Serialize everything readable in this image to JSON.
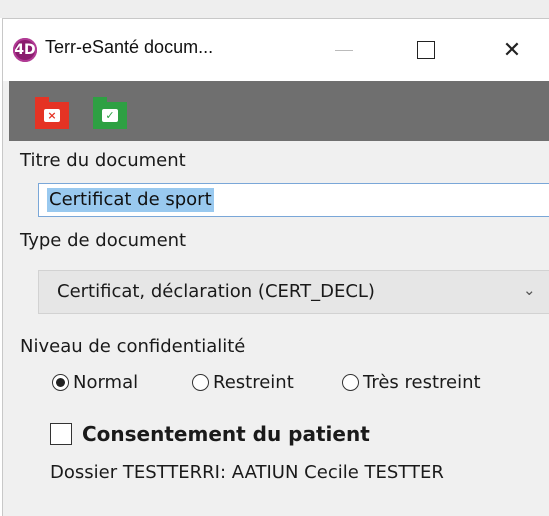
{
  "window": {
    "title": "Terr-eSanté docum...",
    "app_icon_letter": "4D",
    "minimize_glyph": "—",
    "close_glyph": "✕"
  },
  "toolbar": {
    "cancel_icon": "folder-cancel-icon",
    "cancel_glyph": "×",
    "cancel_color": "#e53324",
    "ok_icon": "folder-check-icon",
    "ok_glyph": "✓",
    "ok_color": "#2ea043"
  },
  "form": {
    "titre_label": "Titre du document",
    "titre_value": "Certificat de sport",
    "type_label": "Type de document",
    "type_value": "Certificat, déclaration (CERT_DECL)",
    "niveau_label": "Niveau de confidentialité",
    "niveau_options": [
      {
        "label": "Normal",
        "selected": true
      },
      {
        "label": "Restreint",
        "selected": false
      },
      {
        "label": "Très restreint",
        "selected": false
      }
    ],
    "consent_label": "Consentement du patient",
    "consent_checked": false,
    "dossier_text": "Dossier TESTTERRI: AATIUN Cecile TESTTER"
  }
}
